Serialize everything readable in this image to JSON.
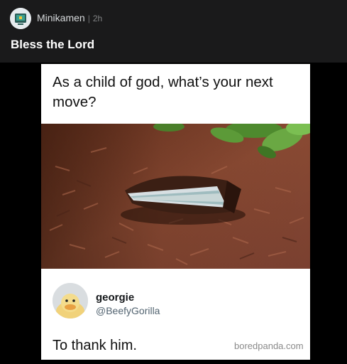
{
  "post": {
    "author": "Minikamen",
    "separator": "|",
    "time": "2h",
    "title": "Bless the Lord"
  },
  "meme": {
    "caption": "As a child of god, what’s your next move?",
    "tweet": {
      "name": "georgie",
      "handle": "@BeefyGorilla",
      "text": "To thank him."
    },
    "watermark": "boredpanda.com"
  }
}
